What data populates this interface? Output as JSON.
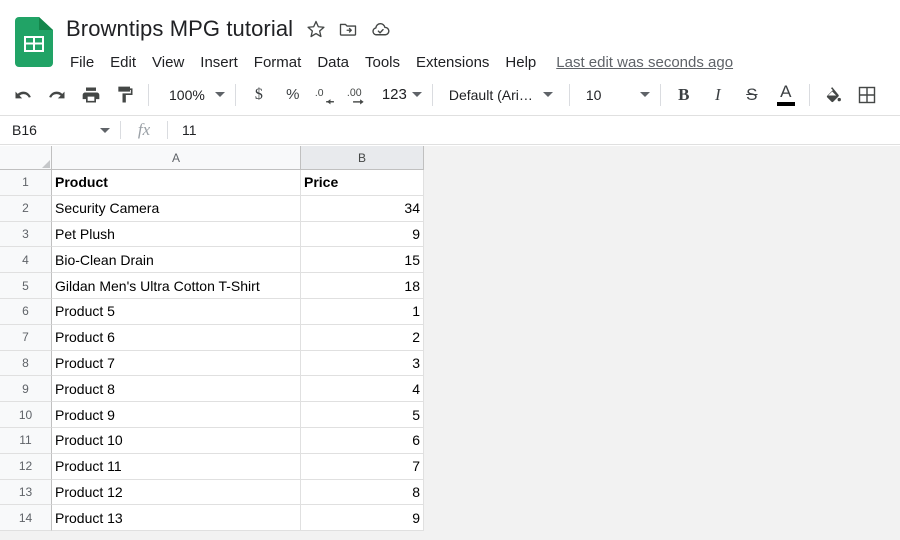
{
  "app": {
    "name": "Google Sheets",
    "logo_icon": "sheets-logo-icon",
    "logo_color": "#21a366"
  },
  "titlebar": {
    "doc_title": "Browntips MPG tutorial",
    "icons": [
      {
        "name": "star-icon",
        "label": "Star"
      },
      {
        "name": "move-to-folder-icon",
        "label": "Move"
      },
      {
        "name": "cloud-saved-icon",
        "label": "Saved to Drive"
      }
    ],
    "menu": [
      {
        "label": "File"
      },
      {
        "label": "Edit"
      },
      {
        "label": "View"
      },
      {
        "label": "Insert"
      },
      {
        "label": "Format"
      },
      {
        "label": "Data"
      },
      {
        "label": "Tools"
      },
      {
        "label": "Extensions"
      },
      {
        "label": "Help"
      }
    ],
    "last_edit": "Last edit was seconds ago"
  },
  "toolbar": {
    "undo_icon": "undo-icon",
    "redo_icon": "redo-icon",
    "print_icon": "print-icon",
    "paint_format_icon": "paint-format-icon",
    "zoom_value": "100%",
    "currency_label": "$",
    "percent_label": "%",
    "decrease_decimal_label": ".0",
    "increase_decimal_label": ".00",
    "number_format_label": "123",
    "font_value": "Default (Ari…",
    "font_size_value": "10",
    "bold_label": "B",
    "italic_label": "I",
    "strikethrough_label": "S",
    "text_color_label": "A",
    "text_color_swatch": "#000000",
    "fill_color_icon": "fill-color-icon",
    "borders_icon": "borders-icon"
  },
  "formula_bar": {
    "name_box_value": "B16",
    "fx_label": "fx",
    "formula_value": "11"
  },
  "grid": {
    "columns": [
      {
        "id": "A",
        "label": "A",
        "selected": false
      },
      {
        "id": "B",
        "label": "B",
        "selected": true
      }
    ],
    "rows": [
      {
        "num": "1",
        "a": "Product",
        "b": "Price",
        "header": true
      },
      {
        "num": "2",
        "a": "Security Camera",
        "b": "34",
        "header": false
      },
      {
        "num": "3",
        "a": "Pet Plush",
        "b": "9",
        "header": false
      },
      {
        "num": "4",
        "a": "Bio-Clean Drain",
        "b": "15",
        "header": false
      },
      {
        "num": "5",
        "a": "Gildan Men's Ultra Cotton T-Shirt",
        "b": "18",
        "header": false
      },
      {
        "num": "6",
        "a": "Product 5",
        "b": "1",
        "header": false
      },
      {
        "num": "7",
        "a": "Product 6",
        "b": "2",
        "header": false
      },
      {
        "num": "8",
        "a": "Product 7",
        "b": "3",
        "header": false
      },
      {
        "num": "9",
        "a": "Product 8",
        "b": "4",
        "header": false
      },
      {
        "num": "10",
        "a": "Product 9",
        "b": "5",
        "header": false
      },
      {
        "num": "11",
        "a": "Product 10",
        "b": "6",
        "header": false
      },
      {
        "num": "12",
        "a": "Product 11",
        "b": "7",
        "header": false
      },
      {
        "num": "13",
        "a": "Product 12",
        "b": "8",
        "header": false
      },
      {
        "num": "14",
        "a": "Product 13",
        "b": "9",
        "header": false
      }
    ]
  },
  "colors": {
    "accent_green": "#21a366",
    "text_primary": "#202124",
    "text_secondary": "#5f6368",
    "grid_line": "#e0e0e0",
    "header_bg": "#f8f9fa",
    "selected_header_bg": "#e8eaed",
    "canvas_bg": "#f2f2f2"
  }
}
